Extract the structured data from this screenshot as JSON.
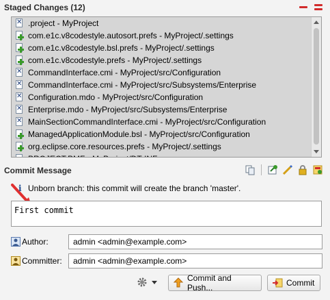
{
  "staged": {
    "title": "Staged Changes (12)",
    "header_icons": [
      "collapse-all-icon",
      "remove-all-icon"
    ],
    "files": [
      {
        "label": ".project - MyProject",
        "icon": "file-cross-icon"
      },
      {
        "label": "com.e1c.v8codestyle.autosort.prefs - MyProject/.settings",
        "icon": "file-add-icon"
      },
      {
        "label": "com.e1c.v8codestyle.bsl.prefs - MyProject/.settings",
        "icon": "file-add-icon"
      },
      {
        "label": "com.e1c.v8codestyle.prefs - MyProject/.settings",
        "icon": "file-add-icon"
      },
      {
        "label": "CommandInterface.cmi - MyProject/src/Configuration",
        "icon": "file-cross-icon"
      },
      {
        "label": "CommandInterface.cmi - MyProject/src/Subsystems/Enterprise",
        "icon": "file-cross-icon"
      },
      {
        "label": "Configuration.mdo - MyProject/src/Configuration",
        "icon": "file-cross-icon"
      },
      {
        "label": "Enterprise.mdo - MyProject/src/Subsystems/Enterprise",
        "icon": "file-cross-icon"
      },
      {
        "label": "MainSectionCommandInterface.cmi - MyProject/src/Configuration",
        "icon": "file-cross-icon"
      },
      {
        "label": "ManagedApplicationModule.bsl - MyProject/src/Configuration",
        "icon": "file-add-icon"
      },
      {
        "label": "org.eclipse.core.resources.prefs - MyProject/.settings",
        "icon": "file-add-icon"
      },
      {
        "label": "PROJECT.PMF - MyProject/DT-INF",
        "icon": "file-add-icon"
      }
    ]
  },
  "commit": {
    "title": "Commit Message",
    "info_text": "Unborn branch: this commit will create the branch 'master'.",
    "message": "First commit",
    "toolbar_icons": [
      "compare-icon",
      "amend-icon",
      "sign-off-icon",
      "lock-icon",
      "push-icon"
    ]
  },
  "author": {
    "label": "Author:",
    "value": "admin <admin@example.com>"
  },
  "committer": {
    "label": "Committer:",
    "value": "admin <admin@example.com>"
  },
  "buttons": {
    "settings_icon": "gear-icon",
    "commit_and_push": "Commit and Push...",
    "commit": "Commit"
  },
  "colors": {
    "accent_red": "#d12b2b",
    "list_bg": "#d6d6d6"
  }
}
